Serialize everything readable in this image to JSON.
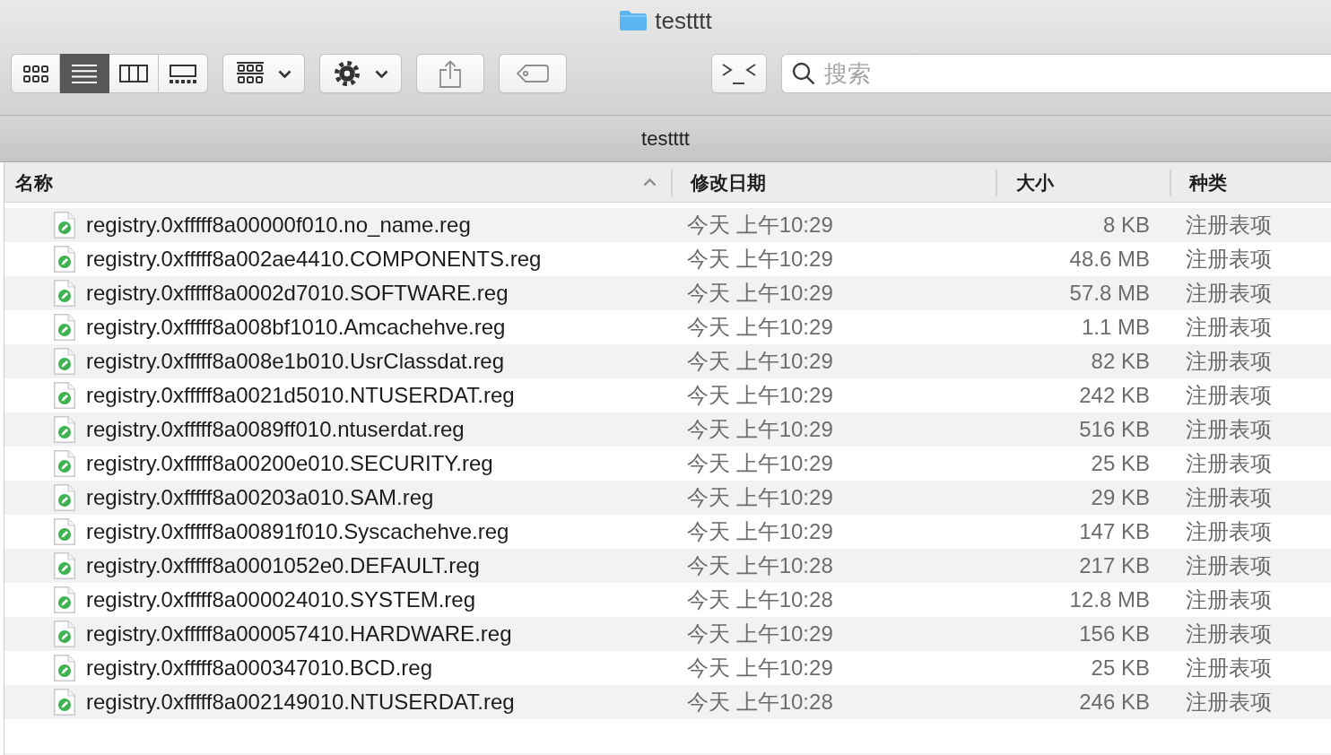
{
  "window": {
    "title": "testttt"
  },
  "toolbar": {
    "view_modes": [
      {
        "kind": "icons",
        "selected": false
      },
      {
        "kind": "list",
        "selected": true
      },
      {
        "kind": "columns",
        "selected": false
      },
      {
        "kind": "gallery",
        "selected": false
      }
    ],
    "search": {
      "placeholder": "搜索"
    }
  },
  "path_bar": {
    "title": "testttt"
  },
  "table": {
    "columns": [
      {
        "label": "名称",
        "sorted": true
      },
      {
        "label": "修改日期",
        "sorted": false
      },
      {
        "label": "大小",
        "sorted": false
      },
      {
        "label": "种类",
        "sorted": false
      }
    ],
    "rows": [
      {
        "name": "registry.0xfffff8a00000f010.no_name.reg",
        "date": "今天 上午10:29",
        "size": "8 KB",
        "kind": "注册表项"
      },
      {
        "name": "registry.0xfffff8a002ae4410.COMPONENTS.reg",
        "date": "今天 上午10:29",
        "size": "48.6 MB",
        "kind": "注册表项"
      },
      {
        "name": "registry.0xfffff8a0002d7010.SOFTWARE.reg",
        "date": "今天 上午10:29",
        "size": "57.8 MB",
        "kind": "注册表项"
      },
      {
        "name": "registry.0xfffff8a008bf1010.Amcachehve.reg",
        "date": "今天 上午10:29",
        "size": "1.1 MB",
        "kind": "注册表项"
      },
      {
        "name": "registry.0xfffff8a008e1b010.UsrClassdat.reg",
        "date": "今天 上午10:29",
        "size": "82 KB",
        "kind": "注册表项"
      },
      {
        "name": "registry.0xfffff8a0021d5010.NTUSERDAT.reg",
        "date": "今天 上午10:29",
        "size": "242 KB",
        "kind": "注册表项"
      },
      {
        "name": "registry.0xfffff8a0089ff010.ntuserdat.reg",
        "date": "今天 上午10:29",
        "size": "516 KB",
        "kind": "注册表项"
      },
      {
        "name": "registry.0xfffff8a00200e010.SECURITY.reg",
        "date": "今天 上午10:29",
        "size": "25 KB",
        "kind": "注册表项"
      },
      {
        "name": "registry.0xfffff8a00203a010.SAM.reg",
        "date": "今天 上午10:29",
        "size": "29 KB",
        "kind": "注册表项"
      },
      {
        "name": "registry.0xfffff8a00891f010.Syscachehve.reg",
        "date": "今天 上午10:29",
        "size": "147 KB",
        "kind": "注册表项"
      },
      {
        "name": "registry.0xfffff8a0001052e0.DEFAULT.reg",
        "date": "今天 上午10:28",
        "size": "217 KB",
        "kind": "注册表项"
      },
      {
        "name": "registry.0xfffff8a000024010.SYSTEM.reg",
        "date": "今天 上午10:28",
        "size": "12.8 MB",
        "kind": "注册表项"
      },
      {
        "name": "registry.0xfffff8a000057410.HARDWARE.reg",
        "date": "今天 上午10:29",
        "size": "156 KB",
        "kind": "注册表项"
      },
      {
        "name": "registry.0xfffff8a000347010.BCD.reg",
        "date": "今天 上午10:29",
        "size": "25 KB",
        "kind": "注册表项"
      },
      {
        "name": "registry.0xfffff8a002149010.NTUSERDAT.reg",
        "date": "今天 上午10:28",
        "size": "246 KB",
        "kind": "注册表项"
      }
    ]
  }
}
